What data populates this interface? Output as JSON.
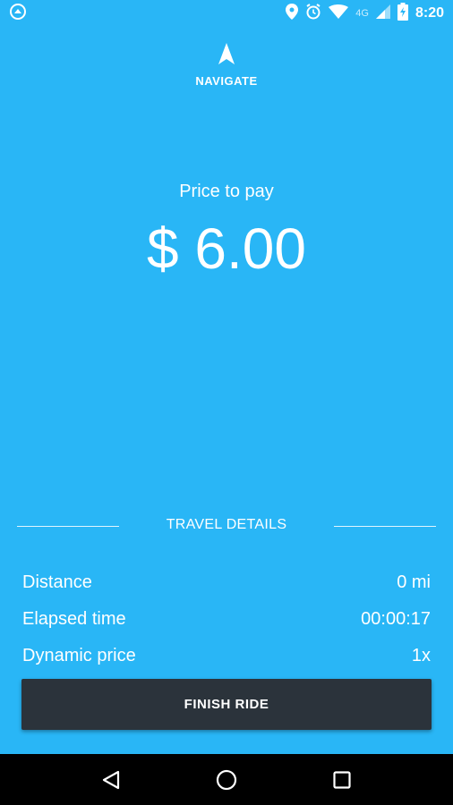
{
  "status_bar": {
    "time": "8:20",
    "network_type": "4G",
    "icons": [
      "app-notification-icon",
      "location-icon",
      "alarm-icon",
      "wifi-icon",
      "cellular-signal-icon",
      "battery-charging-icon"
    ]
  },
  "navigate": {
    "label": "NAVIGATE",
    "icon": "navigation-arrow-icon"
  },
  "price": {
    "label": "Price to pay",
    "value": "$ 6.00"
  },
  "travel_details": {
    "title": "TRAVEL DETAILS",
    "rows": [
      {
        "label": "Distance",
        "value": "0 mi"
      },
      {
        "label": "Elapsed time",
        "value": "00:00:17"
      },
      {
        "label": "Dynamic price",
        "value": "1x"
      }
    ]
  },
  "finish_button": {
    "label": "FINISH RIDE"
  },
  "system_nav": {
    "icons": [
      "back-icon",
      "home-icon",
      "recents-icon"
    ]
  },
  "colors": {
    "background": "#29b6f6",
    "button": "#2b333b",
    "text": "#ffffff"
  }
}
